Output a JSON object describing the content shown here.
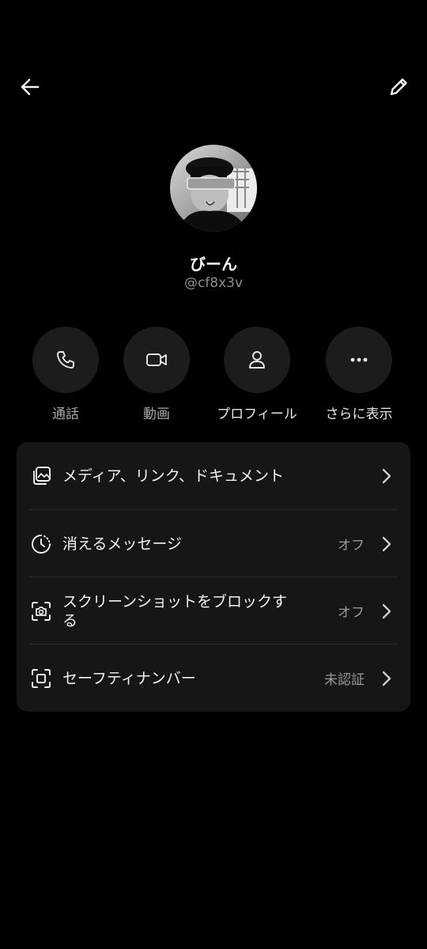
{
  "header": {
    "back_icon": "arrow-left-icon",
    "edit_icon": "pencil-icon"
  },
  "profile": {
    "name": "びーん",
    "handle": "@cf8x3v"
  },
  "actions": [
    {
      "label": "通話",
      "icon": "phone-icon"
    },
    {
      "label": "動画",
      "icon": "video-icon"
    },
    {
      "label": "プロフィール",
      "icon": "person-icon"
    },
    {
      "label": "さらに表示",
      "icon": "more-dots-icon"
    }
  ],
  "settings": [
    {
      "label": "メディア、リンク、ドキュメント",
      "value": "",
      "icon": "media-gallery-icon"
    },
    {
      "label": "消えるメッセージ",
      "value": "オフ",
      "icon": "disappearing-timer-icon"
    },
    {
      "label_line1": "スクリーンショットをブロックす",
      "label_line2": "る",
      "value": "オフ",
      "icon": "screenshot-camera-icon"
    },
    {
      "label": "セーフティナンバー",
      "value": "未認証",
      "icon": "safety-scan-icon"
    }
  ],
  "colors": {
    "background": "#000000",
    "card": "#161618",
    "button_circle": "#1c1c1e",
    "secondary_text": "#8e8e8e"
  }
}
